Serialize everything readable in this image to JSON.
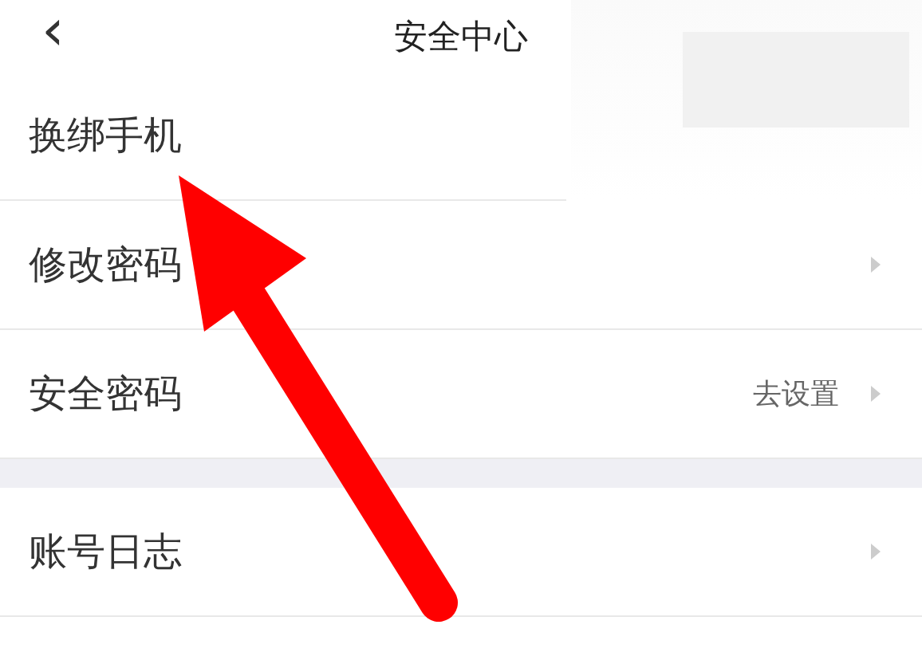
{
  "header": {
    "back_icon": "‹",
    "title": "安全中心"
  },
  "sections": [
    {
      "rows": [
        {
          "label": "换绑手机"
        },
        {
          "label": "修改密码",
          "has_chevron": true
        },
        {
          "label": "安全密码",
          "value": "去设置",
          "has_chevron": true
        }
      ]
    },
    {
      "rows": [
        {
          "label": "账号日志",
          "has_chevron": true
        }
      ]
    }
  ],
  "redacted_area": true,
  "annotations": [
    {
      "kind": "arrow"
    }
  ]
}
